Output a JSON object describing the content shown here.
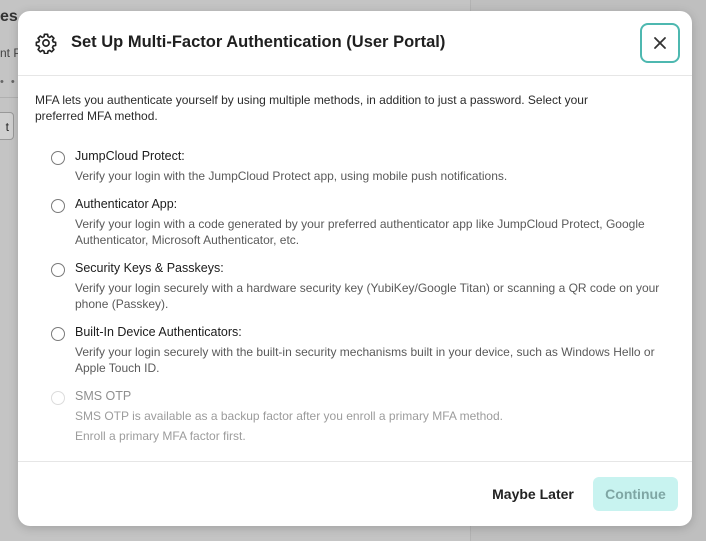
{
  "background": {
    "title_fragment": "es",
    "subtitle_fragment": "nt P",
    "dots": "• • •",
    "button_fragment": "t"
  },
  "modal": {
    "title": "Set Up Multi-Factor Authentication (User Portal)",
    "header_icon": "gear-icon",
    "close_icon": "close-icon",
    "intro": "MFA lets you authenticate yourself by using multiple methods, in addition to just a password. Select your preferred MFA method.",
    "options": [
      {
        "title": "JumpCloud Protect:",
        "description": "Verify your login with the JumpCloud Protect app, using mobile push notifications.",
        "disabled": false
      },
      {
        "title": "Authenticator App:",
        "description": "Verify your login with a code generated by your preferred authenticator app like JumpCloud Protect, Google Authenticator, Microsoft Authenticator, etc.",
        "disabled": false
      },
      {
        "title": "Security Keys & Passkeys:",
        "description": "Verify your login securely with a hardware security key (YubiKey/Google Titan) or scanning a QR code on your phone (Passkey).",
        "disabled": false
      },
      {
        "title": "Built-In Device Authenticators:",
        "description": "Verify your login securely with the built-in security mechanisms built in your device, such as Windows Hello or Apple Touch ID.",
        "disabled": false
      },
      {
        "title": "SMS OTP",
        "description": "SMS OTP is available as a backup factor after you enroll a primary MFA method.",
        "note": "Enroll a primary MFA factor first.",
        "disabled": true
      }
    ],
    "buttons": {
      "maybe_later": "Maybe Later",
      "continue": "Continue"
    }
  },
  "colors": {
    "accent": "#4db8b0",
    "continue_bg": "#c8f3f0",
    "continue_text": "#7fa6a4"
  }
}
